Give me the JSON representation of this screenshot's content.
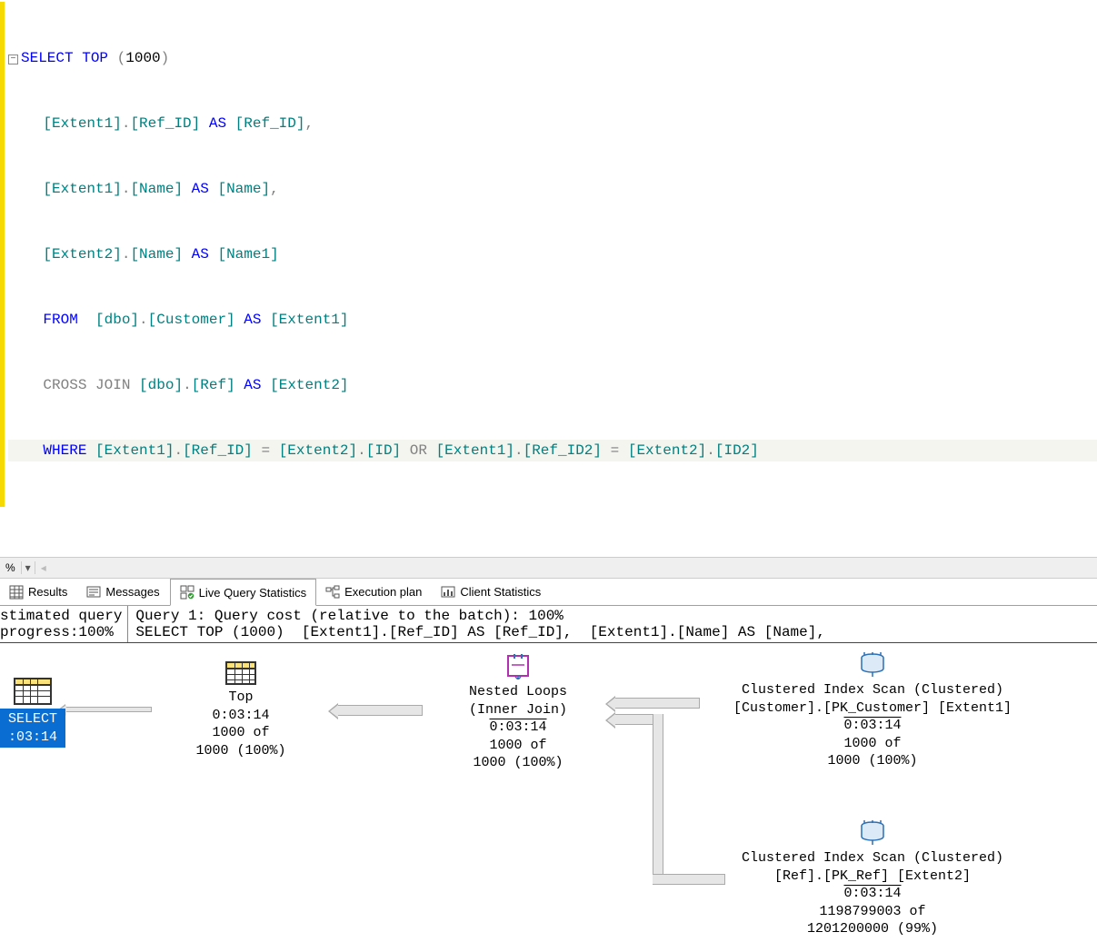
{
  "sql": {
    "line1_select": "SELECT",
    "line1_top": " TOP ",
    "line1_paren_open": "(",
    "line1_num": "1000",
    "line1_paren_close": ")",
    "line2": "    [Extent1].[Ref_ID] AS [Ref_ID],",
    "line2_as": "AS",
    "line3": "    [Extent1].[Name] AS [Name],",
    "line3_as": "AS",
    "line4": "    [Extent2].[Name] AS [Name1]",
    "line4_as": "AS",
    "line5_from": "    FROM",
    "line5_rest": "  [dbo].[Customer] AS [Extent1]",
    "line5_as": "AS",
    "line6_cross": "    CROSS",
    "line6_join": " JOIN",
    "line6_rest": " [dbo].[Ref] AS [Extent2]",
    "line6_as": "AS",
    "line7_where": "    WHERE",
    "line7_cond1": " [Extent1].[Ref_ID] = [Extent2].[ID] ",
    "line7_or": "OR",
    "line7_cond2": " [Extent1].[Ref_ID2] = [Extent2].[ID2]",
    "eq": "="
  },
  "status": {
    "percent_label": " %",
    "dropdown_glyph": "▾",
    "scroll_glyph": "◂"
  },
  "tabs": {
    "results": "Results",
    "messages": "Messages",
    "live": "Live Query Statistics",
    "exec": "Execution plan",
    "client": "Client Statistics"
  },
  "summary": {
    "left_l1": "stimated query",
    "left_l2": "progress:100%",
    "right_l1": "Query 1: Query cost (relative to the batch): 100%",
    "right_l2": "SELECT TOP (1000)  [Extent1].[Ref_ID] AS [Ref_ID],  [Extent1].[Name] AS [Name],"
  },
  "plan": {
    "select": {
      "label": "SELECT",
      "time": ":03:14"
    },
    "top": {
      "label": "Top",
      "time": "0:03:14",
      "rows": "1000 of",
      "rows2": "1000 (100%)"
    },
    "nested": {
      "label": "Nested Loops",
      "sub": "(Inner Join)",
      "time": "0:03:14",
      "rows": "1000 of",
      "rows2": "1000 (100%)"
    },
    "scan1": {
      "label": "Clustered Index Scan (Clustered)",
      "sub": "[Customer].[PK_Customer] [Extent1]",
      "time": "0:03:14",
      "rows": "1000 of",
      "rows2": "1000 (100%)"
    },
    "scan2": {
      "label": "Clustered Index Scan (Clustered)",
      "sub": "[Ref].[PK_Ref] [Extent2]",
      "time": "0:03:14",
      "rows": "1198799003 of",
      "rows2": "1201200000 (99%)"
    }
  }
}
